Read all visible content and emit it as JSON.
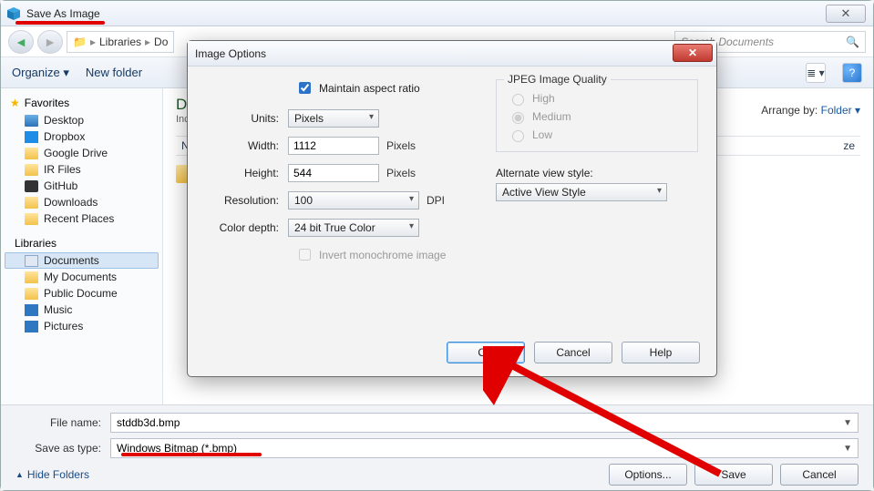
{
  "window": {
    "title": "Save As Image",
    "close_label": "✕"
  },
  "nav": {
    "breadcrumb_root": "Libraries",
    "breadcrumb_next": "Do",
    "search_placeholder": "Search Documents",
    "back_glyph": "◄",
    "fwd_glyph": "►"
  },
  "toolbar": {
    "organize": "Organize ▾",
    "new_folder": "New folder",
    "view_glyph": "≣ ▾",
    "help_glyph": "?"
  },
  "sidebar": {
    "favorites_label": "Favorites",
    "libraries_label": "Libraries",
    "fav_items": [
      {
        "label": "Desktop",
        "cls": "desktop"
      },
      {
        "label": "Dropbox",
        "cls": "dropbox"
      },
      {
        "label": "Google Drive",
        "cls": "folder"
      },
      {
        "label": "IR Files",
        "cls": "folder"
      },
      {
        "label": "GitHub",
        "cls": "github"
      },
      {
        "label": "Downloads",
        "cls": "folder"
      },
      {
        "label": "Recent Places",
        "cls": "folder"
      }
    ],
    "lib_items": [
      {
        "label": "Documents",
        "cls": "doc",
        "selected": true
      },
      {
        "label": "My Documents",
        "cls": "folder"
      },
      {
        "label": "Public Docume",
        "cls": "folder"
      },
      {
        "label": "Music",
        "cls": "music"
      },
      {
        "label": "Pictures",
        "cls": "pic"
      }
    ]
  },
  "main": {
    "heading_prefix": "D",
    "sub": "Inc",
    "arrange_label": "Arrange by:",
    "arrange_value": "Folder ▾",
    "col_name": "Na",
    "col_size": "ze"
  },
  "bottom": {
    "filename_label": "File name:",
    "filename_value": "stddb3d.bmp",
    "type_label": "Save as type:",
    "type_value": "Windows Bitmap (*.bmp)",
    "hide_folders": "Hide Folders",
    "options_btn": "Options...",
    "save_btn": "Save",
    "cancel_btn": "Cancel"
  },
  "imgopt": {
    "title": "Image Options",
    "maintain_aspect": "Maintain aspect ratio",
    "units_label": "Units:",
    "units_value": "Pixels",
    "width_label": "Width:",
    "width_value": "1112",
    "width_unit": "Pixels",
    "height_label": "Height:",
    "height_value": "544",
    "height_unit": "Pixels",
    "resolution_label": "Resolution:",
    "resolution_value": "100",
    "resolution_unit": "DPI",
    "colordepth_label": "Color depth:",
    "colordepth_value": "24 bit True Color",
    "invert_label": "Invert monochrome image",
    "jpeg_legend": "JPEG Image Quality",
    "jpeg_high": "High",
    "jpeg_medium": "Medium",
    "jpeg_low": "Low",
    "altview_label": "Alternate view style:",
    "altview_value": "Active View Style",
    "ok_btn": "OK",
    "cancel_btn": "Cancel",
    "help_btn": "Help",
    "close_glyph": "✕"
  }
}
